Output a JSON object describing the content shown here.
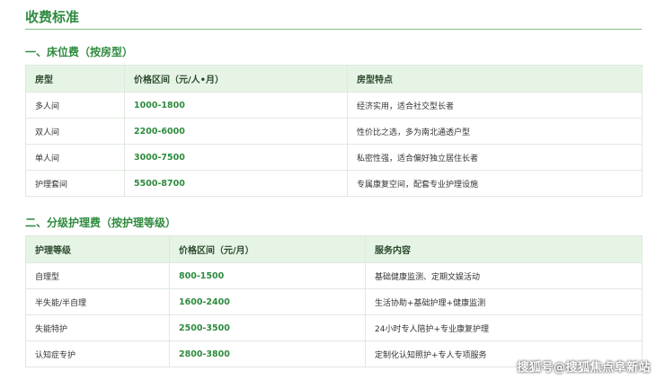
{
  "page": {
    "title": "收费标准"
  },
  "colors": {
    "accent": "#2e8b3e",
    "header_bg": "#e6f4e6",
    "border": "#dfe8df"
  },
  "section1": {
    "title": "一、床位费（按房型）",
    "headers": [
      "房型",
      "价格区间（元/人•月）",
      "房型特点"
    ],
    "rows": [
      [
        "多人间",
        "1000-1800",
        "经济实用，适合社交型长者"
      ],
      [
        "双人间",
        "2200-6000",
        "性价比之选，多为南北通透户型"
      ],
      [
        "单人间",
        "3000-7500",
        "私密性强，适合偏好独立居住长者"
      ],
      [
        "护理套间",
        "5500-8700",
        "专属康复空间，配套专业护理设施"
      ]
    ]
  },
  "section2": {
    "title": "二、分级护理费（按护理等级）",
    "headers": [
      "护理等级",
      "价格区间（元/月）",
      "服务内容"
    ],
    "rows": [
      [
        "自理型",
        "800-1500",
        "基础健康监测、定期文娱活动"
      ],
      [
        "半失能/半自理",
        "1600-2400",
        "生活协助+基础护理+健康监测"
      ],
      [
        "失能特护",
        "2500-3500",
        "24小时专人陪护+专业康复护理"
      ],
      [
        "认知症专护",
        "2800-3800",
        "定制化认知照护+专人专项服务"
      ]
    ]
  },
  "watermark": "搜狐号@搜狐焦点阜新站"
}
